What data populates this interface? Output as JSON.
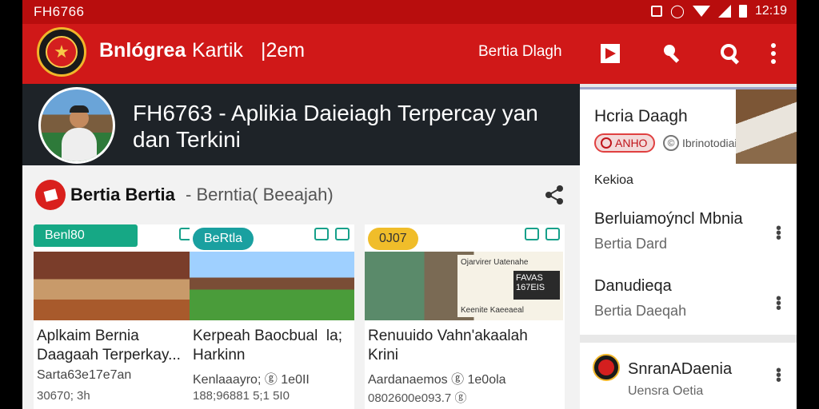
{
  "status_bar": {
    "left_text": "FH6766",
    "time": "12:19"
  },
  "app_bar": {
    "title_a": "Bnlógrea",
    "title_b": "Kartik",
    "title_c": "|2em",
    "right_label": "Bertia Dlagh",
    "colors": {
      "bar": "#d01818",
      "status": "#b80d0d"
    }
  },
  "hero": {
    "title": "FH6763 - Aplikia Daieiagh Terpercay yan dan Terkini"
  },
  "section": {
    "title": "Bertia Bertia",
    "subtitle": "- Berntia( Beeajah)"
  },
  "cards": [
    {
      "tag": "Benl80",
      "tag_color": "#16a885",
      "title": "Aplkaim Bernia Daagaah Terperkay...",
      "meta": "Sarta63e17e7an",
      "date": "30670; 3h"
    },
    {
      "tag": "BeRtla",
      "tag_color": "#1aa0a0",
      "title": "Kerpeah Baocbual  la; Harkinn",
      "meta": "Kenlaaayro; ⓖ 1e0II",
      "date": "188;96881 5;1 5I0"
    },
    {
      "tag": "0J07",
      "tag_color": "#f0bd2a",
      "title": "Renuuido Vahn'akaalah Krini",
      "meta": "Aardanaemos ⓖ 1e0ola",
      "date": "0802600e093.7 ⓖ"
    }
  ],
  "card3_sign": {
    "line1": "Ojarvirer Uatenahe",
    "box": "FAVAS 167EIS",
    "line2": "Keenite Kaeeaeal"
  },
  "right_panel": {
    "top_card": {
      "title": "Hcria Daagh",
      "badge": "ANHO",
      "chip": "Ibrinotodiai"
    },
    "list": {
      "header": "Kekioa",
      "items": [
        {
          "title": "Berluiamoýncl  Mbnia",
          "subtitle": "Bertia Dard"
        },
        {
          "title": "Danudieqa",
          "subtitle": "Bertia Daeqah"
        }
      ]
    },
    "bottom_card": {
      "title": "SnranADaenia",
      "subtitle": "Uensra Oetia"
    }
  }
}
